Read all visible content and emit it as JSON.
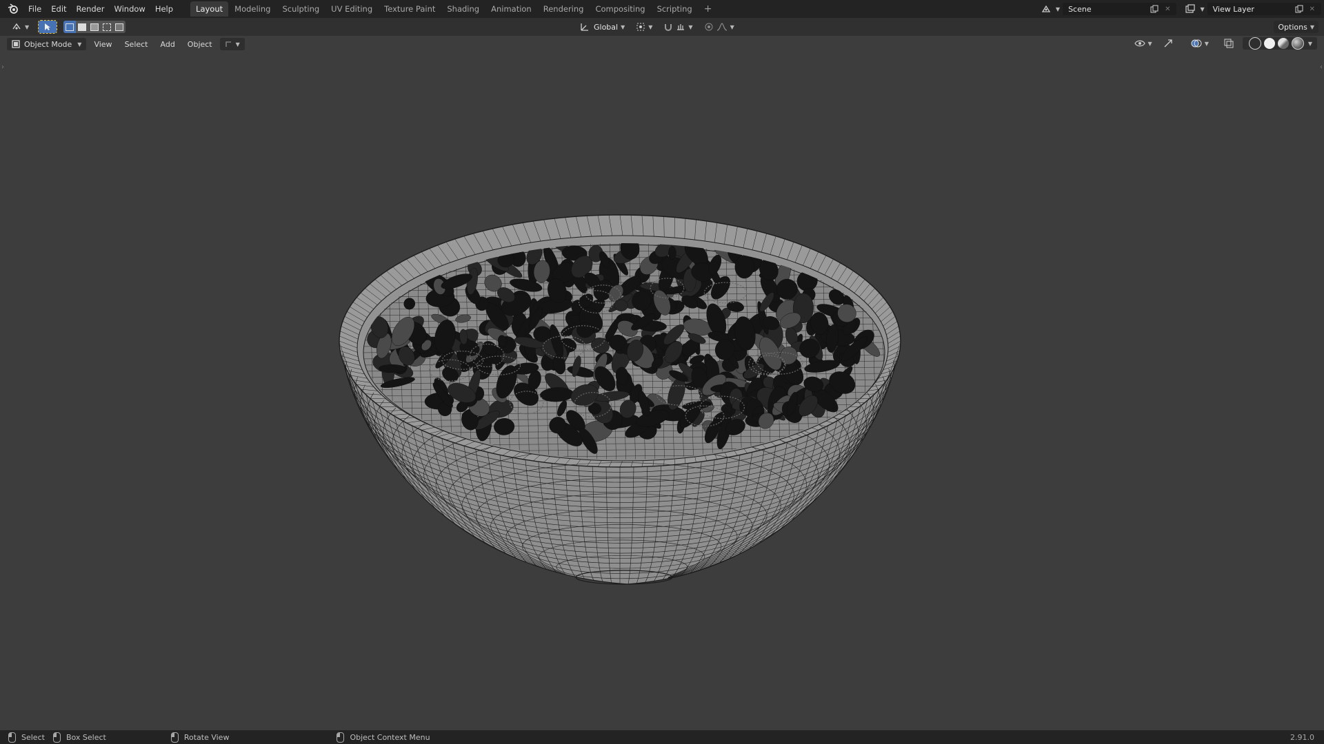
{
  "menubar": {
    "items": [
      "File",
      "Edit",
      "Render",
      "Window",
      "Help"
    ]
  },
  "workspaces": {
    "tabs": [
      "Layout",
      "Modeling",
      "Sculpting",
      "UV Editing",
      "Texture Paint",
      "Shading",
      "Animation",
      "Rendering",
      "Compositing",
      "Scripting"
    ],
    "active": "Layout",
    "add_label": "+"
  },
  "scene": {
    "name": "Scene"
  },
  "view_layer": {
    "name": "View Layer"
  },
  "tool_header": {
    "transform_orientation": "Global",
    "options_label": "Options"
  },
  "viewport_header": {
    "mode": "Object Mode",
    "menus": [
      "View",
      "Select",
      "Add",
      "Object"
    ]
  },
  "statusbar": {
    "select": "Select",
    "box_select": "Box Select",
    "rotate_view": "Rotate View",
    "context_menu": "Object Context Menu",
    "version": "2.91.0"
  },
  "colors": {
    "topbar": "#232323",
    "viewport_bg": "#3d3d3d",
    "accent": "#4772b3",
    "wire": "#1c1c1c"
  }
}
